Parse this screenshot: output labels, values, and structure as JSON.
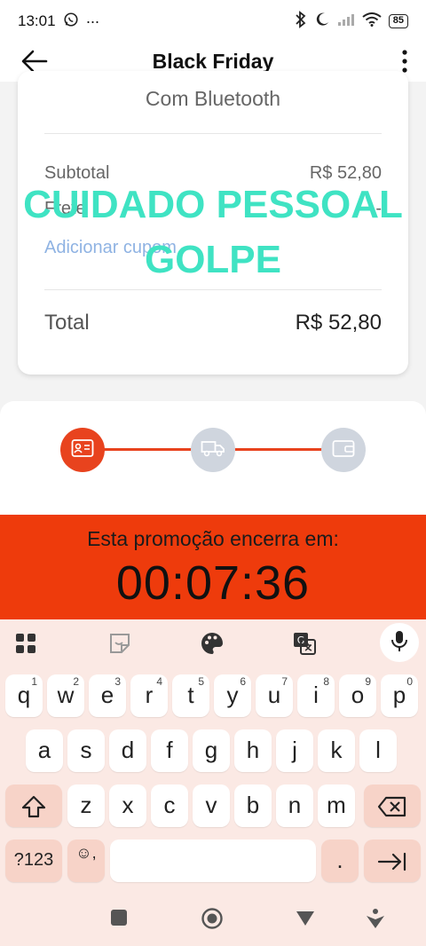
{
  "status": {
    "time": "13:01",
    "battery": "85"
  },
  "header": {
    "title": "Black Friday"
  },
  "card": {
    "product_variant": "Com Bluetooth",
    "subtotal_label": "Subtotal",
    "subtotal_value": "R$ 52,80",
    "frete_label": "Frete",
    "frete_value": "-",
    "coupon_link": "Adicionar cupom",
    "total_label": "Total",
    "total_value": "R$ 52,80"
  },
  "watermark": {
    "line1": "CUIDADO PESSOAL",
    "line2": "GOLPE"
  },
  "steps": [
    {
      "icon": "id-card-icon",
      "active": true
    },
    {
      "icon": "truck-icon",
      "active": false
    },
    {
      "icon": "wallet-icon",
      "active": false
    }
  ],
  "promo": {
    "label": "Esta promoção encerra em:",
    "timer": "00:07:36"
  },
  "keyboard": {
    "row1": [
      "q",
      "w",
      "e",
      "r",
      "t",
      "y",
      "u",
      "i",
      "o",
      "p"
    ],
    "row1_hints": [
      "1",
      "2",
      "3",
      "4",
      "5",
      "6",
      "7",
      "8",
      "9",
      "0"
    ],
    "row2": [
      "a",
      "s",
      "d",
      "f",
      "g",
      "h",
      "j",
      "k",
      "l"
    ],
    "row3": [
      "z",
      "x",
      "c",
      "v",
      "b",
      "n",
      "m"
    ],
    "symbols_key": "?123",
    "emoji_key": "☺,",
    "period_key": "."
  },
  "colors": {
    "accent": "#ee3b0c",
    "step_active": "#e8431e",
    "watermark": "#3fe3c3"
  }
}
